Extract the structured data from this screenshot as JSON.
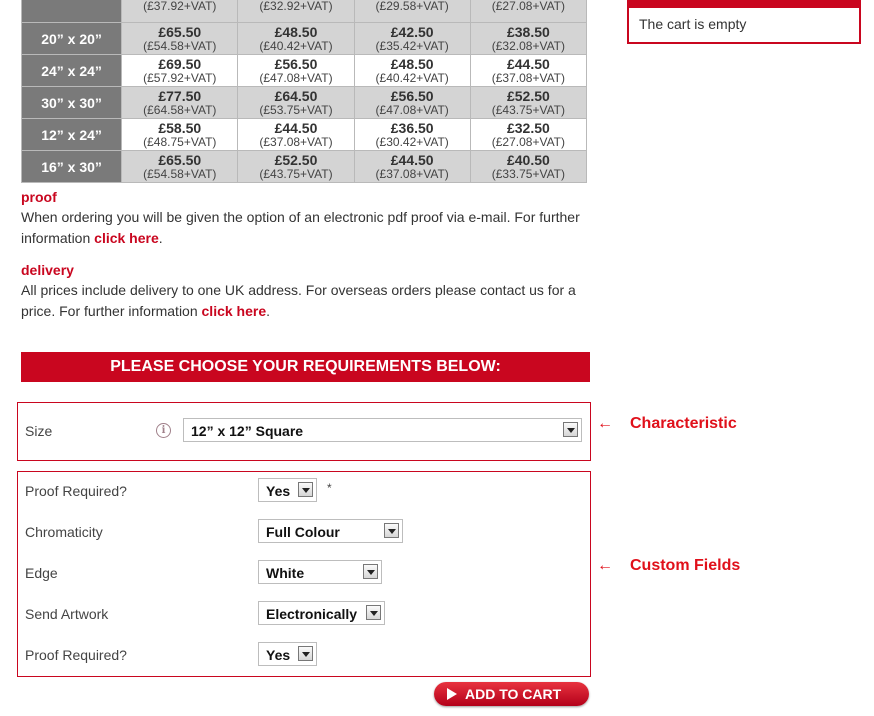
{
  "price_table": {
    "rows": [
      {
        "size": "",
        "cells": [
          {
            "price": "",
            "vat": "(£37.92+VAT)"
          },
          {
            "price": "",
            "vat": "(£32.92+VAT)"
          },
          {
            "price": "",
            "vat": "(£29.58+VAT)"
          },
          {
            "price": "",
            "vat": "(£27.08+VAT)"
          }
        ]
      },
      {
        "size": "20” x 20”",
        "cells": [
          {
            "price": "£65.50",
            "vat": "(£54.58+VAT)"
          },
          {
            "price": "£48.50",
            "vat": "(£40.42+VAT)"
          },
          {
            "price": "£42.50",
            "vat": "(£35.42+VAT)"
          },
          {
            "price": "£38.50",
            "vat": "(£32.08+VAT)"
          }
        ]
      },
      {
        "size": "24” x 24”",
        "cells": [
          {
            "price": "£69.50",
            "vat": "(£57.92+VAT)"
          },
          {
            "price": "£56.50",
            "vat": "(£47.08+VAT)"
          },
          {
            "price": "£48.50",
            "vat": "(£40.42+VAT)"
          },
          {
            "price": "£44.50",
            "vat": "(£37.08+VAT)"
          }
        ]
      },
      {
        "size": "30” x 30”",
        "cells": [
          {
            "price": "£77.50",
            "vat": "(£64.58+VAT)"
          },
          {
            "price": "£64.50",
            "vat": "(£53.75+VAT)"
          },
          {
            "price": "£56.50",
            "vat": "(£47.08+VAT)"
          },
          {
            "price": "£52.50",
            "vat": "(£43.75+VAT)"
          }
        ]
      },
      {
        "size": "12” x 24”",
        "cells": [
          {
            "price": "£58.50",
            "vat": "(£48.75+VAT)"
          },
          {
            "price": "£44.50",
            "vat": "(£37.08+VAT)"
          },
          {
            "price": "£36.50",
            "vat": "(£30.42+VAT)"
          },
          {
            "price": "£32.50",
            "vat": "(£27.08+VAT)"
          }
        ]
      },
      {
        "size": "16” x 30”",
        "cells": [
          {
            "price": "£65.50",
            "vat": "(£54.58+VAT)"
          },
          {
            "price": "£52.50",
            "vat": "(£43.75+VAT)"
          },
          {
            "price": "£44.50",
            "vat": "(£37.08+VAT)"
          },
          {
            "price": "£40.50",
            "vat": "(£33.75+VAT)"
          }
        ]
      }
    ]
  },
  "cart": {
    "empty_text": "The cart is empty"
  },
  "proof": {
    "heading": "proof",
    "text": "When ordering you will be given the option of an electronic pdf proof via e-mail. For further information ",
    "link": "click here",
    "suffix": "."
  },
  "delivery": {
    "heading": "delivery",
    "text": "All prices include delivery to one UK address. For overseas orders please contact us for a price. For further information ",
    "link": "click here",
    "suffix": "."
  },
  "banner": "PLEASE CHOOSE YOUR REQUIREMENTS BELOW:",
  "characteristic": {
    "label": "Size",
    "info": "i",
    "value": "12” x 12” Square"
  },
  "custom_fields": [
    {
      "label": "Proof Required?",
      "value": "Yes"
    },
    {
      "label": "Chromaticity",
      "value": "Full Colour"
    },
    {
      "label": "Edge",
      "value": "White"
    },
    {
      "label": "Send Artwork",
      "value": "Electronically"
    },
    {
      "label": "Proof Required?",
      "value": "Yes"
    }
  ],
  "required_marker": "*",
  "annotations": {
    "arrow": "←",
    "characteristic": "Characteristic",
    "custom_fields": "Custom Fields"
  },
  "add_to_cart": "ADD TO CART",
  "colors": {
    "accent": "#c9061f",
    "size_cell": "#7a7a7a",
    "alt_row": "#d4d4d4"
  }
}
